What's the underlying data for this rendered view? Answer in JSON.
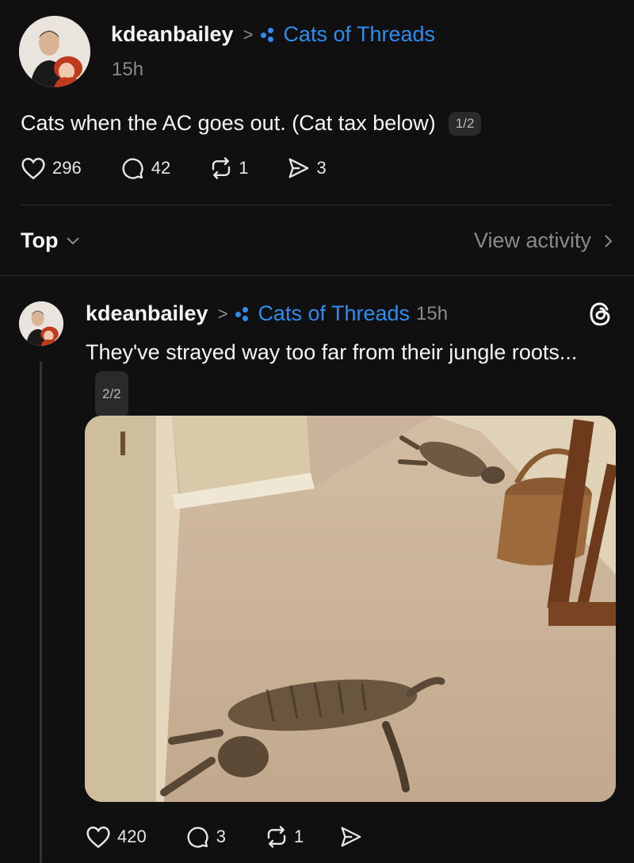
{
  "post": {
    "username": "kdeanbailey",
    "community": "Cats of Threads",
    "time": "15h",
    "text": "Cats when the AC goes out. (Cat tax below)",
    "page_badge": "1/2",
    "likes": "296",
    "replies": "42",
    "reposts": "1",
    "shares": "3"
  },
  "sort": {
    "label": "Top",
    "view_activity": "View activity"
  },
  "reply": {
    "username": "kdeanbailey",
    "community": "Cats of Threads",
    "time": "15h",
    "text": "They've strayed way too far from their jungle roots...",
    "page_badge": "2/2",
    "likes": "420",
    "replies": "3",
    "reposts": "1"
  },
  "colors": {
    "background": "#101010",
    "accent": "#2f8cf0",
    "muted": "#8a8a8a"
  }
}
